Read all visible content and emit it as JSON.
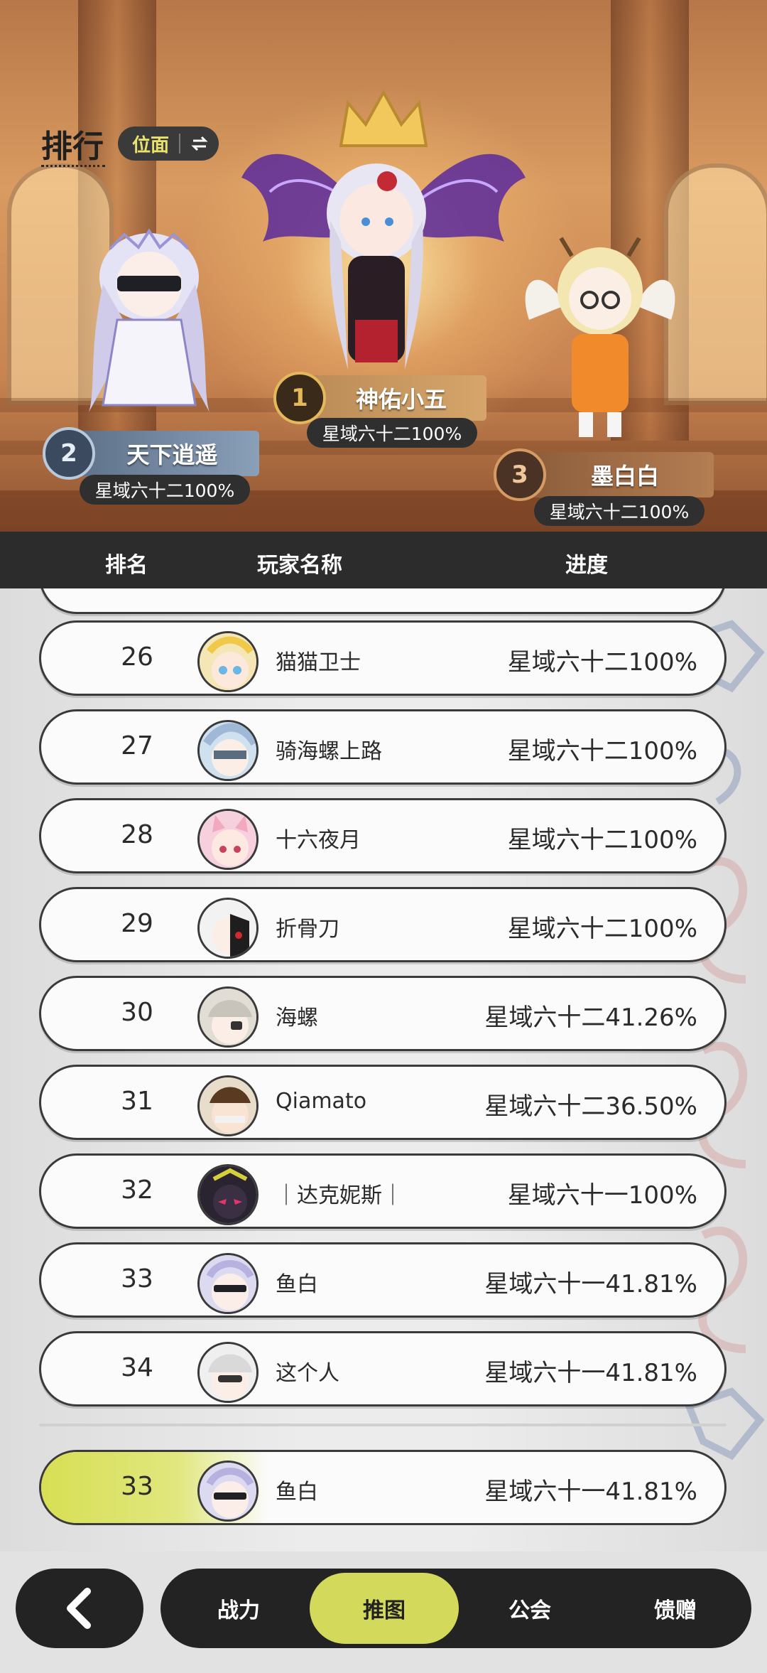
{
  "header": {
    "title": "排行",
    "switch_label": "位面",
    "switch_icon": "swap-arrows-icon"
  },
  "podium": [
    {
      "rank": "1",
      "name": "神佑小五",
      "progress": "星域六十二100%"
    },
    {
      "rank": "2",
      "name": "天下逍遥",
      "progress": "星域六十二100%"
    },
    {
      "rank": "3",
      "name": "墨白白",
      "progress": "星域六十二100%"
    }
  ],
  "columns": {
    "rank": "排名",
    "player": "玩家名称",
    "progress": "进度"
  },
  "rows": [
    {
      "rank": "26",
      "name": "猫猫卫士",
      "progress": "星域六十二100%"
    },
    {
      "rank": "27",
      "name": "骑海螺上路",
      "progress": "星域六十二100%"
    },
    {
      "rank": "28",
      "name": "十六夜月",
      "progress": "星域六十二100%"
    },
    {
      "rank": "29",
      "name": "折骨刀",
      "progress": "星域六十二100%"
    },
    {
      "rank": "30",
      "name": "海螺",
      "progress": "星域六十二41.26%"
    },
    {
      "rank": "31",
      "name": "Qiamato",
      "progress": "星域六十二36.50%"
    },
    {
      "rank": "32",
      "name": "｜达克妮斯｜",
      "progress": "星域六十一100%"
    },
    {
      "rank": "33",
      "name": "鱼白",
      "progress": "星域六十一41.81%"
    },
    {
      "rank": "34",
      "name": "这个人",
      "progress": "星域六十一41.81%"
    }
  ],
  "self": {
    "rank": "33",
    "name": "鱼白",
    "progress": "星域六十一41.81%"
  },
  "nav": {
    "back_icon": "back-arrow-icon",
    "tabs": [
      {
        "label": "战力",
        "active": false
      },
      {
        "label": "推图",
        "active": true
      },
      {
        "label": "公会",
        "active": false
      },
      {
        "label": "馈赠",
        "active": false
      }
    ]
  },
  "colors": {
    "accent": "#d3d95a",
    "dark": "#232323",
    "gold": "#c9a24a"
  }
}
